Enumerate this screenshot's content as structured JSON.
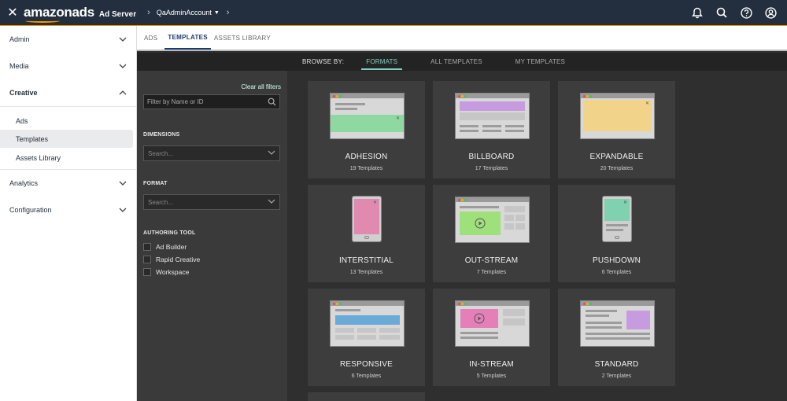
{
  "app": {
    "close_glyph": "✕",
    "logo": "amazonads",
    "product": "Ad Server",
    "account": "QaAdminAccount",
    "colors": {
      "accent": "#ff9900",
      "topbar": "#232f3e",
      "teal": "#7fd1c4"
    }
  },
  "icons": [
    "bell-icon",
    "search-icon",
    "help-icon",
    "user-icon"
  ],
  "sidebar": {
    "sections": [
      {
        "label": "Admin",
        "expanded": false
      },
      {
        "label": "Media",
        "expanded": false
      },
      {
        "label": "Creative",
        "expanded": true
      },
      {
        "label": "Analytics",
        "expanded": false
      },
      {
        "label": "Configuration",
        "expanded": false
      }
    ],
    "creative_items": [
      "Ads",
      "Templates",
      "Assets Library"
    ],
    "active_item": "Templates"
  },
  "tabs": [
    {
      "label": "ADS",
      "active": false
    },
    {
      "label": "TEMPLATES",
      "active": true
    },
    {
      "label": "ASSETS LIBRARY",
      "active": false
    }
  ],
  "browse": {
    "label": "BROWSE BY:",
    "options": [
      "FORMATS",
      "ALL TEMPLATES",
      "MY TEMPLATES"
    ],
    "active": "FORMATS"
  },
  "filters": {
    "clear_label": "Clear all filters",
    "search_placeholder": "Filter by Name or ID",
    "dimensions_label": "DIMENSIONS",
    "dimensions_placeholder": "Search...",
    "format_label": "FORMAT",
    "format_placeholder": "Search...",
    "authoring_label": "AUTHORING TOOL",
    "authoring_options": [
      {
        "label": "Ad Builder",
        "checked": false
      },
      {
        "label": "Rapid Creative",
        "checked": false
      },
      {
        "label": "Workspace",
        "checked": false
      }
    ]
  },
  "formats": [
    {
      "name": "ADHESION",
      "count": "19 Templates",
      "color": "#8fd9a0"
    },
    {
      "name": "BILLBOARD",
      "count": "17 Templates",
      "color": "#c79be0"
    },
    {
      "name": "EXPANDABLE",
      "count": "20 Templates",
      "color": "#f2d38a"
    },
    {
      "name": "INTERSTITIAL",
      "count": "13 Templates",
      "color": "#e08ab0"
    },
    {
      "name": "OUT-STREAM",
      "count": "7 Templates",
      "color": "#9ee07a"
    },
    {
      "name": "PUSHDOWN",
      "count": "6 Templates",
      "color": "#7fd1b0"
    },
    {
      "name": "RESPONSIVE",
      "count": "6 Templates",
      "color": "#6aaad8"
    },
    {
      "name": "IN-STREAM",
      "count": "5 Templates",
      "color": "#e57fb8"
    },
    {
      "name": "STANDARD",
      "count": "2 Templates",
      "color": "#c79be0"
    }
  ]
}
